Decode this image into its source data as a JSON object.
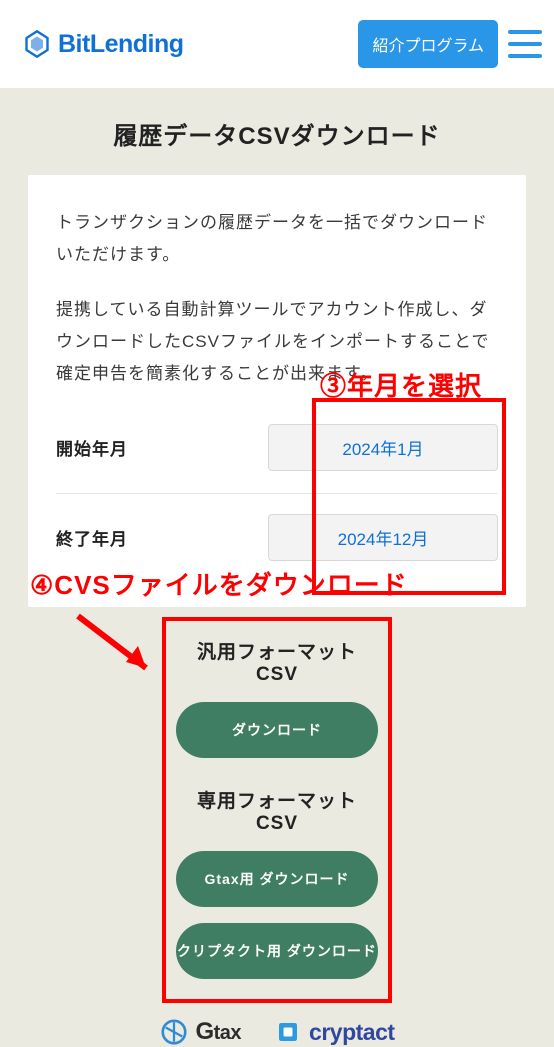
{
  "header": {
    "brand": "BitLending",
    "promo_button": "紹介プログラム"
  },
  "page_title": "履歴データCSVダウンロード",
  "description": {
    "p1": "トランザクションの履歴データを一括でダウンロードいただけます。",
    "p2": "提携している自動計算ツールでアカウント作成し、ダウンロードしたCSVファイルをインポートすることで確定申告を簡素化することが出来ます。"
  },
  "date_fields": {
    "start_label": "開始年月",
    "start_value": "2024年1月",
    "end_label": "終了年月",
    "end_value": "2024年12月"
  },
  "annotations": {
    "step3": "③年月を選択",
    "step4": "④CVSファイルをダウンロード"
  },
  "downloads": {
    "generic_title": "汎用フォーマットCSV",
    "generic_button": "ダウンロード",
    "tool_title": "専用フォーマットCSV",
    "gtax_button": "Gtax用 ダウンロード",
    "cryptact_button": "クリプタクト用 ダウンロード"
  },
  "partners": {
    "gtax": "Gtax",
    "cryptact": "cryptact"
  }
}
